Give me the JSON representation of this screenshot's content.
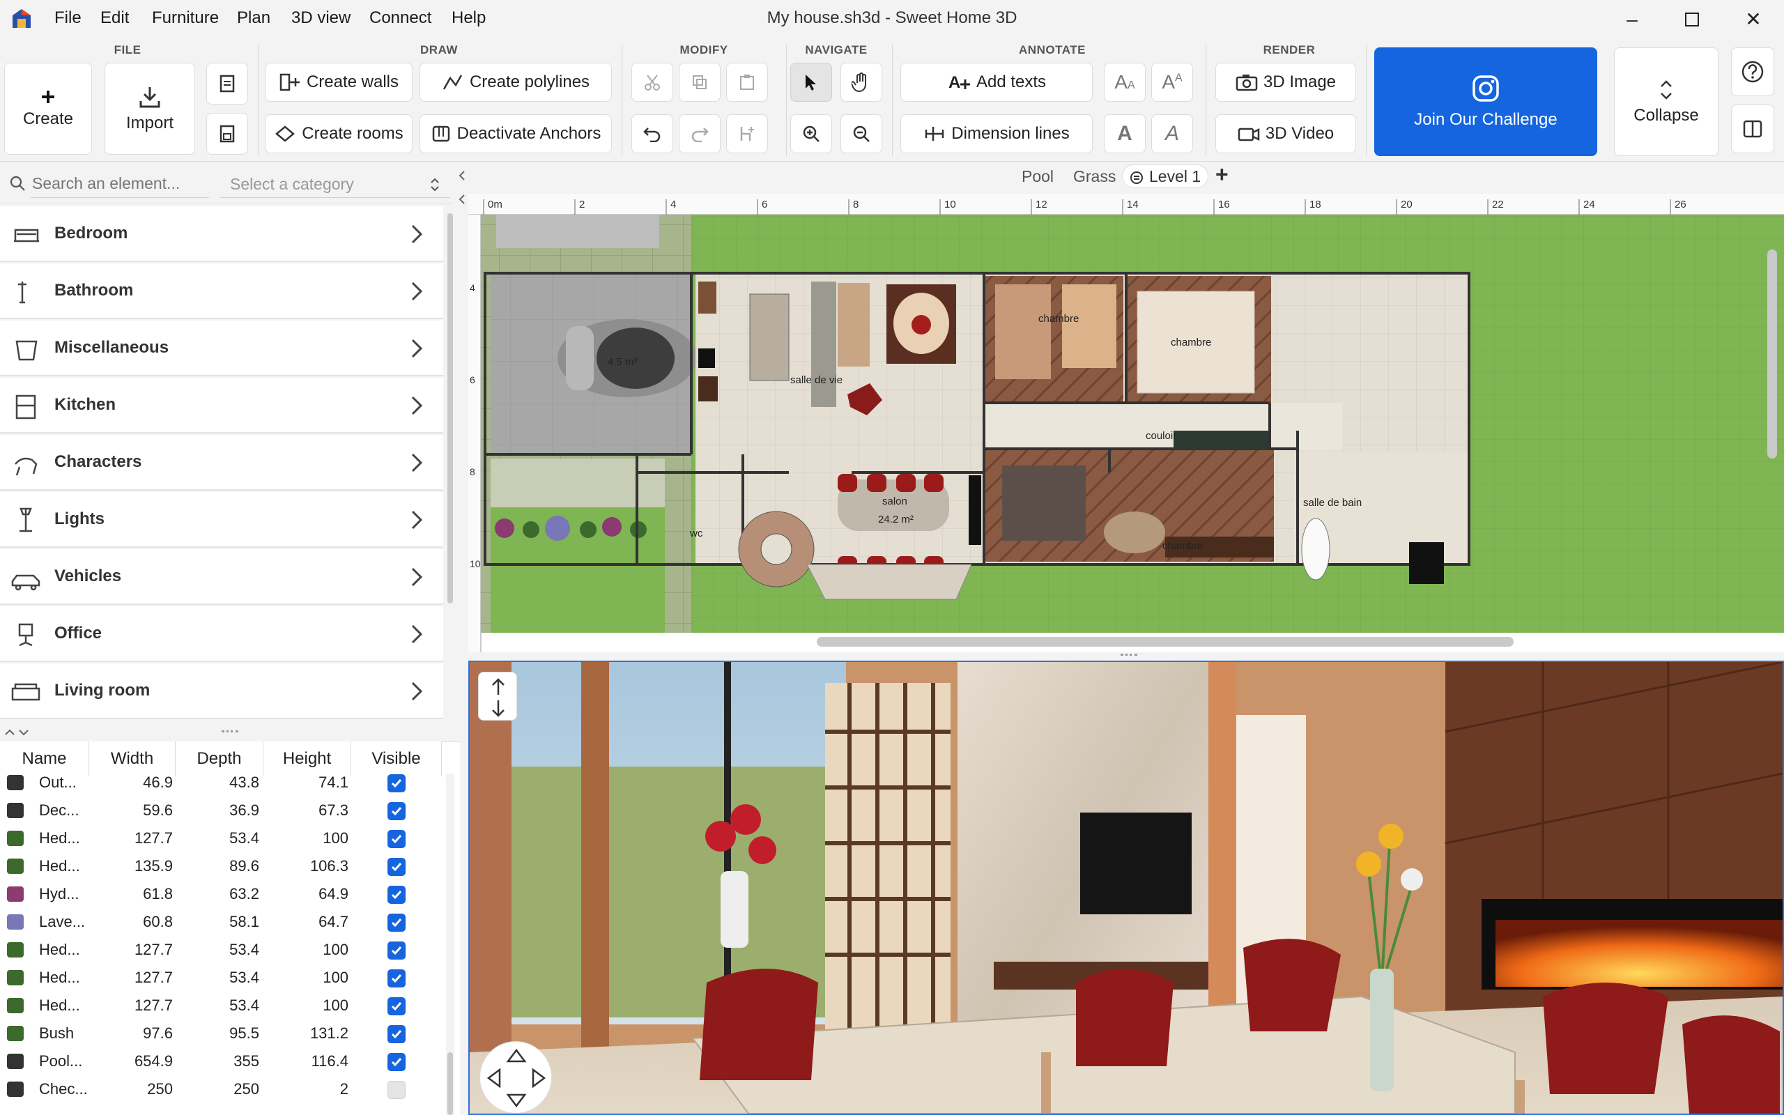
{
  "window": {
    "title": "My house.sh3d - Sweet Home 3D"
  },
  "menu": [
    "File",
    "Edit",
    "Furniture",
    "Plan",
    "3D view",
    "Connect",
    "Help"
  ],
  "ribbon": {
    "groups": [
      "FILE",
      "DRAW",
      "MODIFY",
      "NAVIGATE",
      "ANNOTATE",
      "RENDER"
    ],
    "create": "Create",
    "import": "Import",
    "create_walls": "Create walls",
    "create_polylines": "Create polylines",
    "create_rooms": "Create rooms",
    "deactivate_anchors": "Deactivate Anchors",
    "add_texts": "Add texts",
    "dimension_lines": "Dimension lines",
    "image_3d": "3D Image",
    "video_3d": "3D Video",
    "challenge": "Join Our Challenge",
    "collapse": "Collapse"
  },
  "search": {
    "placeholder": "Search an element...",
    "category_placeholder": "Select a category"
  },
  "categories": [
    "Bedroom",
    "Bathroom",
    "Miscellaneous",
    "Kitchen",
    "Characters",
    "Lights",
    "Vehicles",
    "Office",
    "Living room"
  ],
  "table": {
    "headers": [
      "Name",
      "Width",
      "Depth",
      "Height",
      "Visible"
    ],
    "rows": [
      {
        "name": "Out...",
        "width": "46.9",
        "depth": "43.8",
        "height": "74.1",
        "visible": true
      },
      {
        "name": "Dec...",
        "width": "59.6",
        "depth": "36.9",
        "height": "67.3",
        "visible": true
      },
      {
        "name": "Hed...",
        "width": "127.7",
        "depth": "53.4",
        "height": "100",
        "visible": true
      },
      {
        "name": "Hed...",
        "width": "135.9",
        "depth": "89.6",
        "height": "106.3",
        "visible": true
      },
      {
        "name": "Hyd...",
        "width": "61.8",
        "depth": "63.2",
        "height": "64.9",
        "visible": true
      },
      {
        "name": "Lave...",
        "width": "60.8",
        "depth": "58.1",
        "height": "64.7",
        "visible": true
      },
      {
        "name": "Hed...",
        "width": "127.7",
        "depth": "53.4",
        "height": "100",
        "visible": true
      },
      {
        "name": "Hed...",
        "width": "127.7",
        "depth": "53.4",
        "height": "100",
        "visible": true
      },
      {
        "name": "Hed...",
        "width": "127.7",
        "depth": "53.4",
        "height": "100",
        "visible": true
      },
      {
        "name": "Bush",
        "width": "97.6",
        "depth": "95.5",
        "height": "131.2",
        "visible": true
      },
      {
        "name": "Pool...",
        "width": "654.9",
        "depth": "355",
        "height": "116.4",
        "visible": true
      },
      {
        "name": "Chec...",
        "width": "250",
        "depth": "250",
        "height": "2",
        "visible": false
      }
    ]
  },
  "plan": {
    "levels": [
      "Pool",
      "Grass",
      "Level 1"
    ],
    "add_level": "+",
    "ruler_x": [
      "0m",
      "2",
      "4",
      "6",
      "8",
      "10",
      "12",
      "14",
      "16",
      "18",
      "20",
      "22",
      "24",
      "26"
    ],
    "ruler_y": [
      "4",
      "6",
      "8",
      "10"
    ],
    "rooms": {
      "garage_area": "4.5 m²",
      "living": "salle de vie",
      "bedroom1": "chambre",
      "bedroom2": "chambre",
      "bedroom3": "chambre",
      "corridor": "couloir",
      "bathroom": "salle de bain",
      "wc": "wc",
      "lounge": "salon",
      "lounge_area": "24.2 m²"
    }
  },
  "colors": {
    "accent": "#1565e0",
    "grass": "#7fb552",
    "floor": "#e6e1d7",
    "chair": "#9b1b1b"
  }
}
